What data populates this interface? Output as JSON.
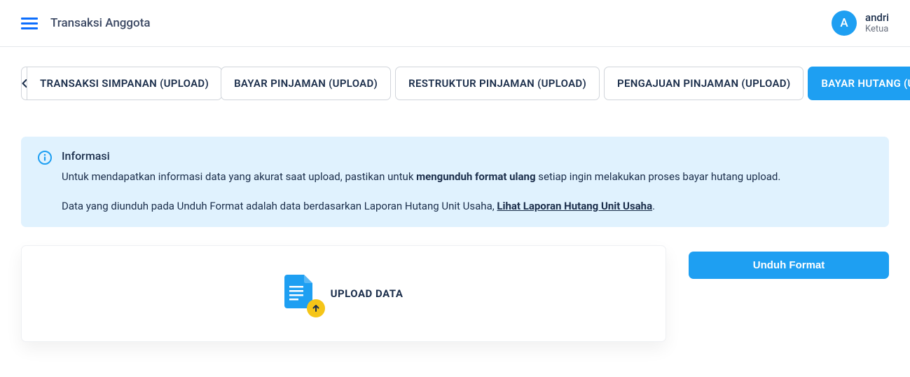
{
  "header": {
    "title": "Transaksi Anggota",
    "user": {
      "initial": "A",
      "name": "andri",
      "role": "Ketua"
    }
  },
  "tabs": [
    {
      "label": "TRANSAKSI SIMPANAN (UPLOAD)",
      "active": false
    },
    {
      "label": "BAYAR PINJAMAN (UPLOAD)",
      "active": false
    },
    {
      "label": "RESTRUKTUR PINJAMAN (UPLOAD)",
      "active": false
    },
    {
      "label": "PENGAJUAN PINJAMAN (UPLOAD)",
      "active": false
    },
    {
      "label": "BAYAR HUTANG (UPLOAD)",
      "active": true
    }
  ],
  "info": {
    "title": "Informasi",
    "p1_before": "Untuk mendapatkan informasi data yang akurat saat upload, pastikan untuk ",
    "p1_bold": "mengunduh format ulang",
    "p1_after": " setiap ingin melakukan proses bayar hutang upload.",
    "p2_before": "Data yang diunduh pada Unduh Format adalah data berdasarkan Laporan Hutang Unit Usaha, ",
    "p2_link": "Lihat Laporan Hutang Unit Usaha",
    "p2_after": "."
  },
  "upload": {
    "label": "UPLOAD DATA"
  },
  "download_button": "Unduh Format"
}
